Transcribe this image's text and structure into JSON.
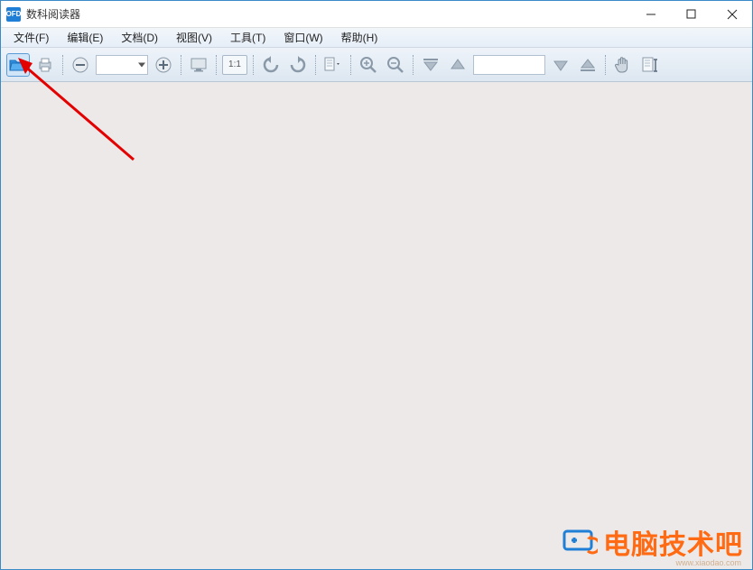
{
  "titlebar": {
    "icon_text": "OFD",
    "title": "数科阅读器"
  },
  "menubar": {
    "items": [
      "文件(F)",
      "编辑(E)",
      "文档(D)",
      "视图(V)",
      "工具(T)",
      "窗口(W)",
      "帮助(H)"
    ]
  },
  "toolbar": {
    "zoom_value": "",
    "ratio_label": "1:1",
    "page_value": ""
  },
  "watermark": {
    "text": "电脑技术吧",
    "url": "www.xiaodao.com"
  }
}
